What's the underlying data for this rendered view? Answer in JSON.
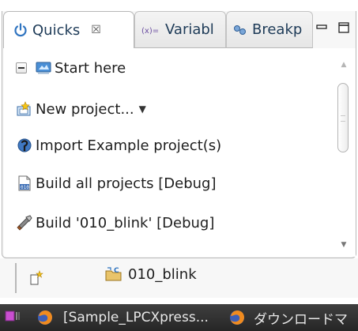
{
  "tabs": [
    {
      "label": "Quicks",
      "icon": "quickstart-icon",
      "active": true,
      "close_glyph": "☒"
    },
    {
      "label": "Variabl",
      "icon": "variables-icon",
      "active": false
    },
    {
      "label": "Breakp",
      "icon": "breakpoints-icon",
      "active": false
    }
  ],
  "view_controls": {
    "minimize": "minimize-view-icon",
    "maximize": "maximize-view-icon"
  },
  "quickstart": {
    "section_title": "Start here",
    "items": [
      {
        "label": "New project...",
        "icon": "new-project-icon",
        "has_dropdown": true,
        "dropdown_glyph": "▼"
      },
      {
        "label": "Import Example project(s)",
        "icon": "import-icon"
      },
      {
        "label": "Build all projects [Debug]",
        "icon": "build-all-icon"
      },
      {
        "label": "Build '010_blink' [Debug]",
        "icon": "build-icon"
      }
    ]
  },
  "scrollbar": {
    "up_glyph": "▲",
    "down_glyph": "▼"
  },
  "project_strip": {
    "project_name": "010_blink"
  },
  "taskbar": {
    "items": [
      {
        "label": "[Sample_LPCXpress...",
        "icon": "firefox-icon"
      },
      {
        "label": "ダウンロードマ",
        "icon": "firefox-icon"
      }
    ]
  },
  "colors": {
    "tab_text": "#1d3a57",
    "taskbar_bg": "#2e2e2e",
    "accent_blue": "#2f74c0"
  }
}
